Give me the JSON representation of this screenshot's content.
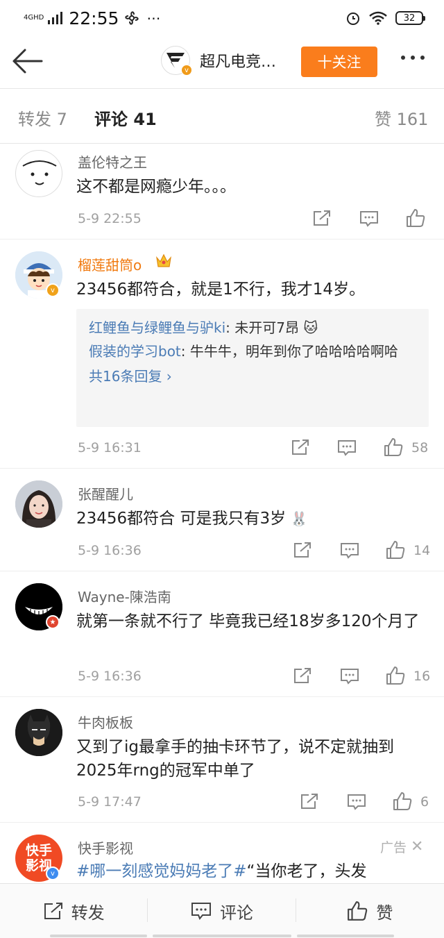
{
  "status_bar": {
    "network": "4GHD",
    "time": "22:55",
    "battery": "32"
  },
  "header": {
    "account_name": "超凡电竞…",
    "follow_label": "十关注"
  },
  "tabs": {
    "repost": "转发 7",
    "comment": "评论 41",
    "like": "赞 161"
  },
  "comments": [
    {
      "user": "盖伦特之王",
      "text": "这不都是网瘾少年。。。",
      "time": "5-9 22:55",
      "likes": ""
    },
    {
      "user": "榴莲甜筒o",
      "text": "23456都符合，就是1不行，我才14岁。",
      "time": "5-9 16:31",
      "likes": "58",
      "replies": [
        {
          "user": "红鲤鱼与绿鲤鱼与驴ki",
          "text": ": 未开可7昂"
        },
        {
          "user": "假装的学习bot",
          "text": ": 牛牛牛，明年到你了哈哈哈哈啊哈"
        }
      ],
      "reply_more": "共16条回复"
    },
    {
      "user": "张醒醒儿",
      "text": "23456都符合 可是我只有3岁",
      "time": "5-9 16:36",
      "likes": "14"
    },
    {
      "user": "Wayne-陳浩南",
      "text": "就第一条就不行了  毕竟我已经18岁多120个月了",
      "time": "5-9 16:36",
      "likes": "16"
    },
    {
      "user": "牛肉板板",
      "text": "又到了ig最拿手的抽卡环节了，说不定就抽到2025年rng的冠军中单了",
      "time": "5-9 17:47",
      "likes": "6"
    }
  ],
  "ad": {
    "user": "快手影视",
    "avatar_text": "快手影视",
    "label": "广告",
    "hashtag": "#哪一刻感觉妈妈老了#",
    "text": "“当你老了，头发"
  },
  "bottom_bar": {
    "repost": "转发",
    "comment": "评论",
    "like": "赞"
  },
  "colors": {
    "accent_orange": "#fa7d1c",
    "link_blue": "#4a7bb5",
    "vip_name": "#f07a10"
  }
}
